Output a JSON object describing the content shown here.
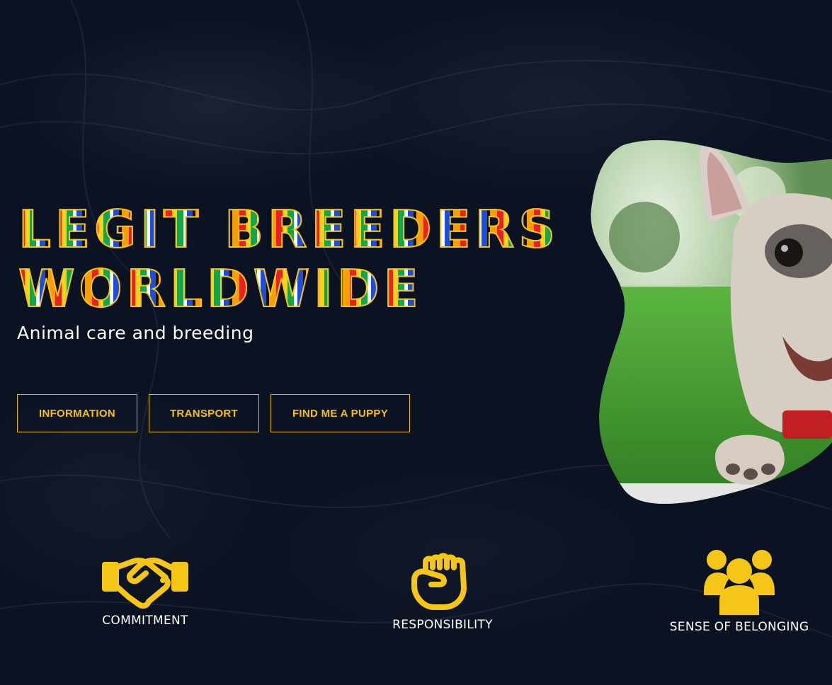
{
  "hero": {
    "title_line1": "LEGIT BREEDERS",
    "title_line2": "WORLDWIDE",
    "subtitle": "Animal care and breeding"
  },
  "buttons": {
    "information": "INFORMATION",
    "transport": "TRANSPORT",
    "find_puppy": "FIND ME A PUPPY"
  },
  "features": [
    {
      "label": "COMMITMENT",
      "icon": "handshake-icon"
    },
    {
      "label": "RESPONSIBILITY",
      "icon": "fist-icon"
    },
    {
      "label": "SENSE OF BELONGING",
      "icon": "group-icon"
    }
  ],
  "hero_image": {
    "subject": "french-bulldog-photo"
  },
  "colors": {
    "background": "#0b1221",
    "accent": "#f5c518",
    "text": "#ffffff"
  }
}
